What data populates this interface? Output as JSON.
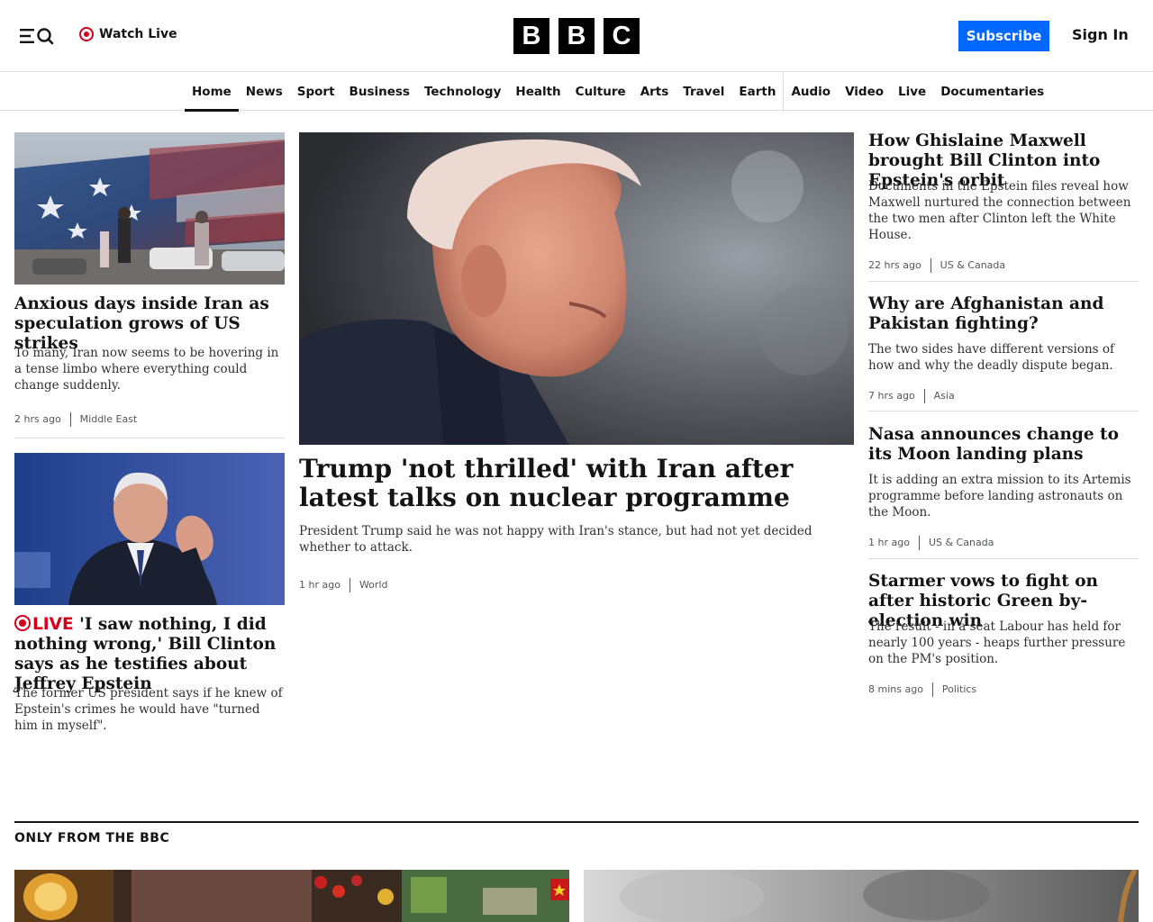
{
  "header": {
    "watch_live_label": "Watch Live",
    "logo_letters": [
      "B",
      "B",
      "C"
    ],
    "subscribe_label": "Subscribe",
    "signin_label": "Sign In",
    "menu_icon": "menu-search-icon",
    "live_icon": "live-dot-icon",
    "accent_color": "#0068ff",
    "live_color": "#d4001a"
  },
  "nav": {
    "items": [
      "Home",
      "News",
      "Sport",
      "Business",
      "Technology",
      "Health",
      "Culture",
      "Arts",
      "Travel",
      "Earth",
      "Audio",
      "Video",
      "Live",
      "Documentaries"
    ],
    "active": "Home"
  },
  "left": {
    "story1": {
      "headline": "Anxious days inside Iran as speculation grows of US strikes",
      "summary": "To many, Iran now seems to be hovering in a tense limbo where everything could change suddenly.",
      "time": "2 hrs ago",
      "category": "Middle East"
    },
    "story2": {
      "live_label": "LIVE",
      "headline": "'I saw nothing, I did nothing wrong,' Bill Clinton says as he testifies about Jeffrey Epstein",
      "summary": "The former US president says if he knew of Epstein's crimes he would have \"turned him in myself\"."
    }
  },
  "center": {
    "headline": "Trump 'not thrilled' with Iran after latest talks on nuclear programme",
    "summary": "President Trump said he was not happy with Iran's stance, but had not yet decided whether to attack.",
    "time": "1 hr ago",
    "category": "World"
  },
  "right": {
    "stories": [
      {
        "headline": "How Ghislaine Maxwell brought Bill Clinton into Epstein's orbit",
        "summary": "Documents in the Epstein files reveal how Maxwell nurtured the connection between the two men after Clinton left the White House.",
        "time": "22 hrs ago",
        "category": "US & Canada"
      },
      {
        "headline": "Why are Afghanistan and Pakistan fighting?",
        "summary": "The two sides have different versions of how and why the deadly dispute began.",
        "time": "7 hrs ago",
        "category": "Asia"
      },
      {
        "headline": "Nasa announces change to its Moon landing plans",
        "summary": "It is adding an extra mission to its Artemis programme before landing astronauts on the Moon.",
        "time": "1 hr ago",
        "category": "US & Canada"
      },
      {
        "headline": "Starmer vows to fight on after historic Green by-election win",
        "summary": "The result - in a seat Labour has held for nearly 100 years - heaps further pressure on the PM's position.",
        "time": "8 mins ago",
        "category": "Politics"
      }
    ]
  },
  "section": {
    "title": "ONLY FROM THE BBC"
  }
}
